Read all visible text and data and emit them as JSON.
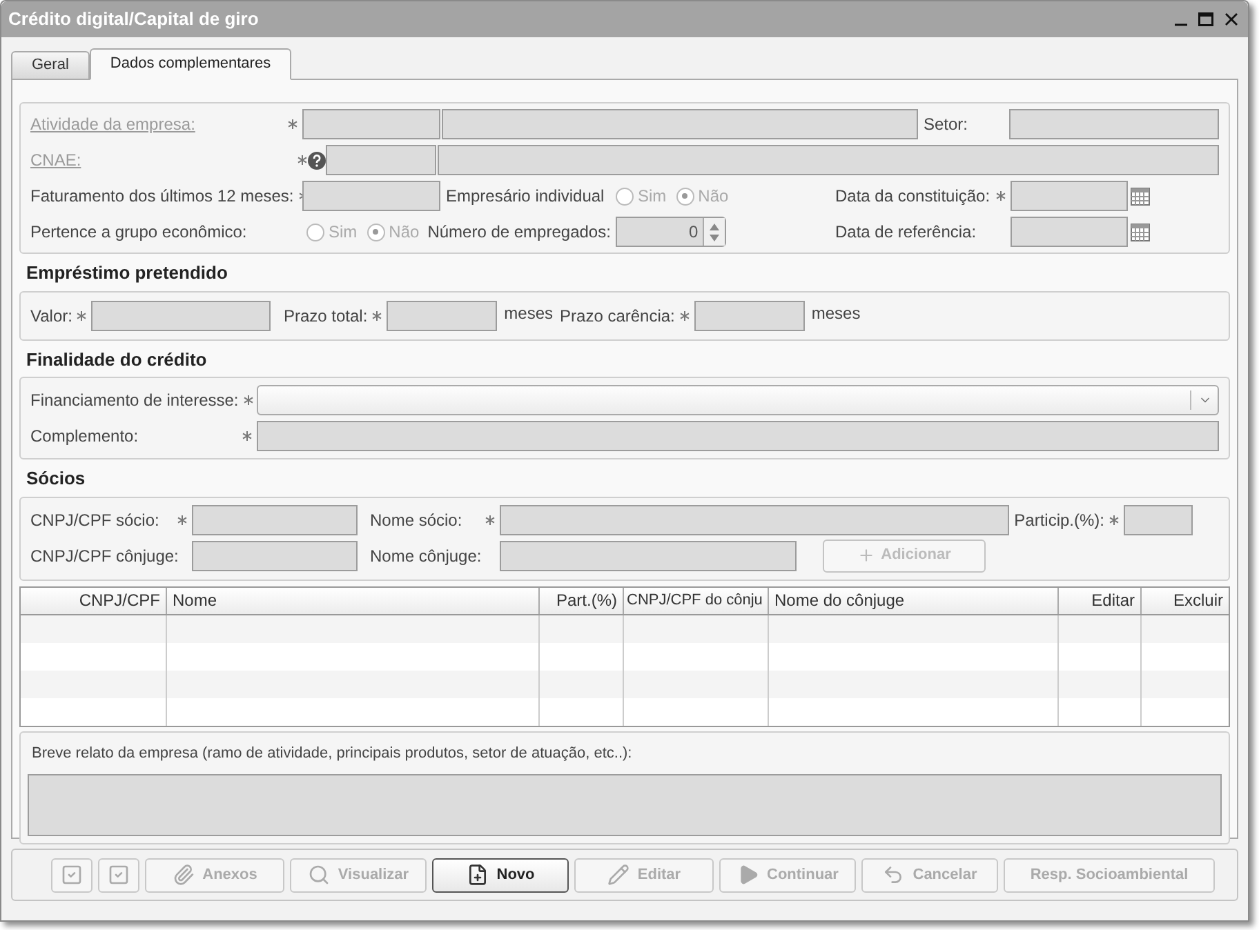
{
  "window": {
    "title": "Crédito digital/Capital de giro"
  },
  "tabs": [
    {
      "label": "Geral",
      "selected": false
    },
    {
      "label": "Dados complementares",
      "selected": true
    }
  ],
  "company": {
    "activity": {
      "label": "Atividade da empresa:",
      "disabled": true,
      "required": true
    },
    "sector": {
      "label": "Setor:"
    },
    "cnae": {
      "label": "CNAE:",
      "disabled": true,
      "required": true
    },
    "revenue": {
      "label": "Faturamento dos últimos 12 meses:",
      "required": true
    },
    "sole_proprietor": {
      "label": "Empresário individual",
      "disabled": true,
      "options": [
        {
          "label": "Sim",
          "selected": false
        },
        {
          "label": "Não",
          "selected": true
        }
      ]
    },
    "founding_date": {
      "label": "Data da constituição:",
      "required": true
    },
    "economic_group": {
      "label": "Pertence a grupo econômico:",
      "disabled": true,
      "options": [
        {
          "label": "Sim",
          "selected": false
        },
        {
          "label": "Não",
          "selected": true
        }
      ]
    },
    "employees": {
      "label": "Número de empregados:",
      "value": "0"
    },
    "reference_date": {
      "label": "Data de referência:"
    }
  },
  "loan": {
    "title": "Empréstimo pretendido",
    "amount": {
      "label": "Valor:",
      "required": true
    },
    "term": {
      "label": "Prazo total:",
      "required": true,
      "unit": "meses"
    },
    "grace": {
      "label": "Prazo carência:",
      "required": true,
      "unit": "meses"
    }
  },
  "purpose": {
    "title": "Finalidade do crédito",
    "financing": {
      "label": "Financiamento de interesse:",
      "required": true
    },
    "complement": {
      "label": "Complemento:",
      "required": true
    }
  },
  "partners": {
    "title": "Sócios",
    "partner_id": {
      "label": "CNPJ/CPF sócio:",
      "required": true
    },
    "partner_name": {
      "label": "Nome sócio:",
      "required": true
    },
    "share": {
      "label": "Particip.(%):",
      "required": true
    },
    "spouse_id": {
      "label": "CNPJ/CPF cônjuge:"
    },
    "spouse_name": {
      "label": "Nome cônjuge:"
    },
    "add_button": {
      "label": "Adicionar",
      "disabled": true
    }
  },
  "table": {
    "columns": [
      {
        "label": "CNPJ/CPF"
      },
      {
        "label": "Nome"
      },
      {
        "label": "Part.(%)"
      },
      {
        "label": "CNPJ/CPF do cônju"
      },
      {
        "label": "Nome do cônjuge"
      },
      {
        "label": "Editar"
      },
      {
        "label": "Excluir"
      }
    ]
  },
  "description": {
    "label": "Breve relato da empresa (ramo de atividade, principais produtos, setor de atuação, etc..):"
  },
  "toolbar": [
    {
      "kind": "check",
      "disabled": true
    },
    {
      "kind": "check",
      "disabled": true
    },
    {
      "kind": "clip",
      "label": "Anexos",
      "disabled": true
    },
    {
      "kind": "search",
      "label": "Visualizar",
      "disabled": true
    },
    {
      "kind": "new",
      "label": "Novo",
      "disabled": false
    },
    {
      "kind": "pencil",
      "label": "Editar",
      "disabled": true
    },
    {
      "kind": "play",
      "label": "Continuar",
      "disabled": true
    },
    {
      "kind": "undo",
      "label": "Cancelar",
      "disabled": true
    },
    {
      "kind": "none",
      "label": "Resp. Socioambiental",
      "disabled": true
    }
  ]
}
